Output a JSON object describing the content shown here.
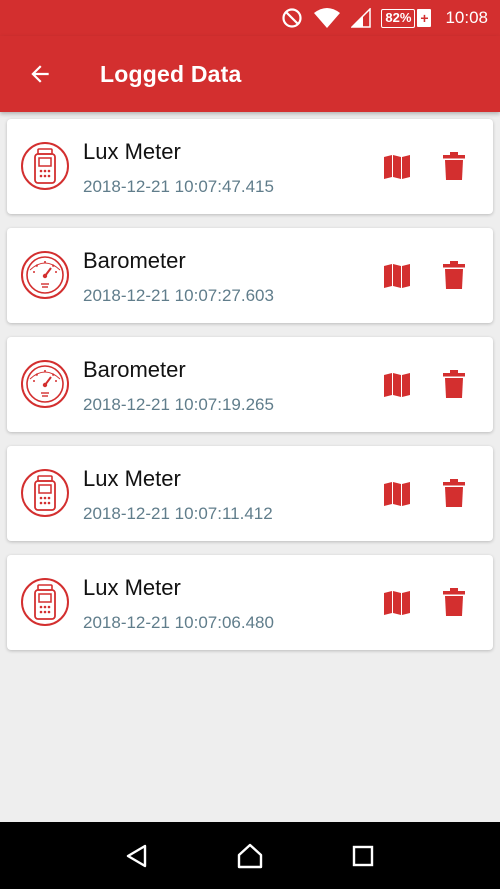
{
  "status_bar": {
    "battery_percent": "82%",
    "battery_charging": "+",
    "time": "10:08",
    "icons": [
      "do-not-disturb-icon",
      "wifi-icon",
      "cell-signal-icon",
      "battery-icon"
    ]
  },
  "app_bar": {
    "title": "Logged Data",
    "back_icon": "arrow-back-icon"
  },
  "colors": {
    "primary": "#d32f2f",
    "timestamp": "#607d8b",
    "background": "#eeeeee"
  },
  "entries": [
    {
      "title": "Lux Meter",
      "timestamp": "2018-12-21 10:07:47.415",
      "icon": "lux-meter-icon"
    },
    {
      "title": "Barometer",
      "timestamp": "2018-12-21 10:07:27.603",
      "icon": "barometer-icon"
    },
    {
      "title": "Barometer",
      "timestamp": "2018-12-21 10:07:19.265",
      "icon": "barometer-icon"
    },
    {
      "title": "Lux Meter",
      "timestamp": "2018-12-21 10:07:11.412",
      "icon": "lux-meter-icon"
    },
    {
      "title": "Lux Meter",
      "timestamp": "2018-12-21 10:07:06.480",
      "icon": "lux-meter-icon"
    }
  ],
  "nav_bar": {
    "buttons": [
      "back-triangle-icon",
      "home-icon",
      "recents-icon"
    ]
  }
}
